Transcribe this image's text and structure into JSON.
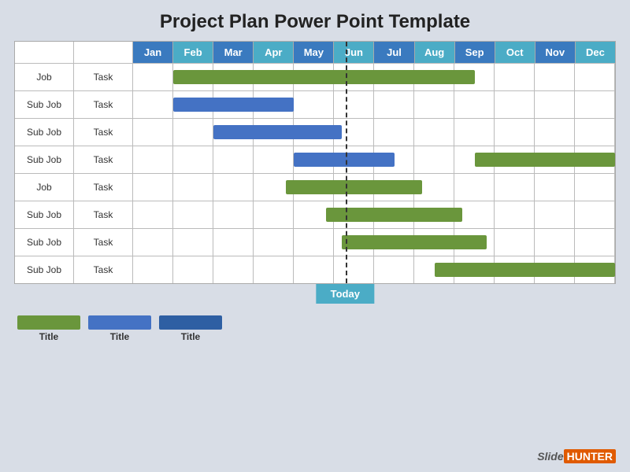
{
  "title": "Project Plan Power Point Template",
  "months": [
    "Jan",
    "Feb",
    "Mar",
    "Apr",
    "May",
    "Jun",
    "Jul",
    "Aug",
    "Sep",
    "Oct",
    "Nov",
    "Dec"
  ],
  "monthColors": [
    "blue",
    "teal",
    "blue",
    "teal",
    "blue",
    "teal",
    "blue",
    "teal",
    "blue",
    "teal",
    "blue",
    "teal"
  ],
  "rows": [
    {
      "job": "Job",
      "task": "Task",
      "barColor": "green",
      "start": 1,
      "end": 8.5
    },
    {
      "job": "Sub Job",
      "task": "Task",
      "barColor": "blue",
      "start": 1,
      "end": 4
    },
    {
      "job": "Sub Job",
      "task": "Task",
      "barColor": "blue",
      "start": 2,
      "end": 5.2
    },
    {
      "job": "Sub Job",
      "task": "Task",
      "barColor": "blue",
      "start": 4,
      "end": 6.5,
      "extra": {
        "barColor": "green",
        "start": 8.5,
        "end": 12
      }
    },
    {
      "job": "Job",
      "task": "Task",
      "barColor": "green",
      "start": 3.8,
      "end": 7.2
    },
    {
      "job": "Sub Job",
      "task": "Task",
      "barColor": "green",
      "start": 4.8,
      "end": 8.2
    },
    {
      "job": "Sub Job",
      "task": "Task",
      "barColor": "green",
      "start": 5.2,
      "end": 8.8
    },
    {
      "job": "Sub Job",
      "task": "Task",
      "barColor": "green",
      "start": 7.5,
      "end": 12
    }
  ],
  "todayPosition": 5.3,
  "todayLabel": "Today",
  "legend": [
    {
      "color": "green",
      "label": "Title"
    },
    {
      "color": "blue",
      "label": "Title"
    },
    {
      "color": "darkblue",
      "label": "Title"
    }
  ],
  "logo": {
    "slide": "Slide",
    "hunter": "HUNTER"
  }
}
